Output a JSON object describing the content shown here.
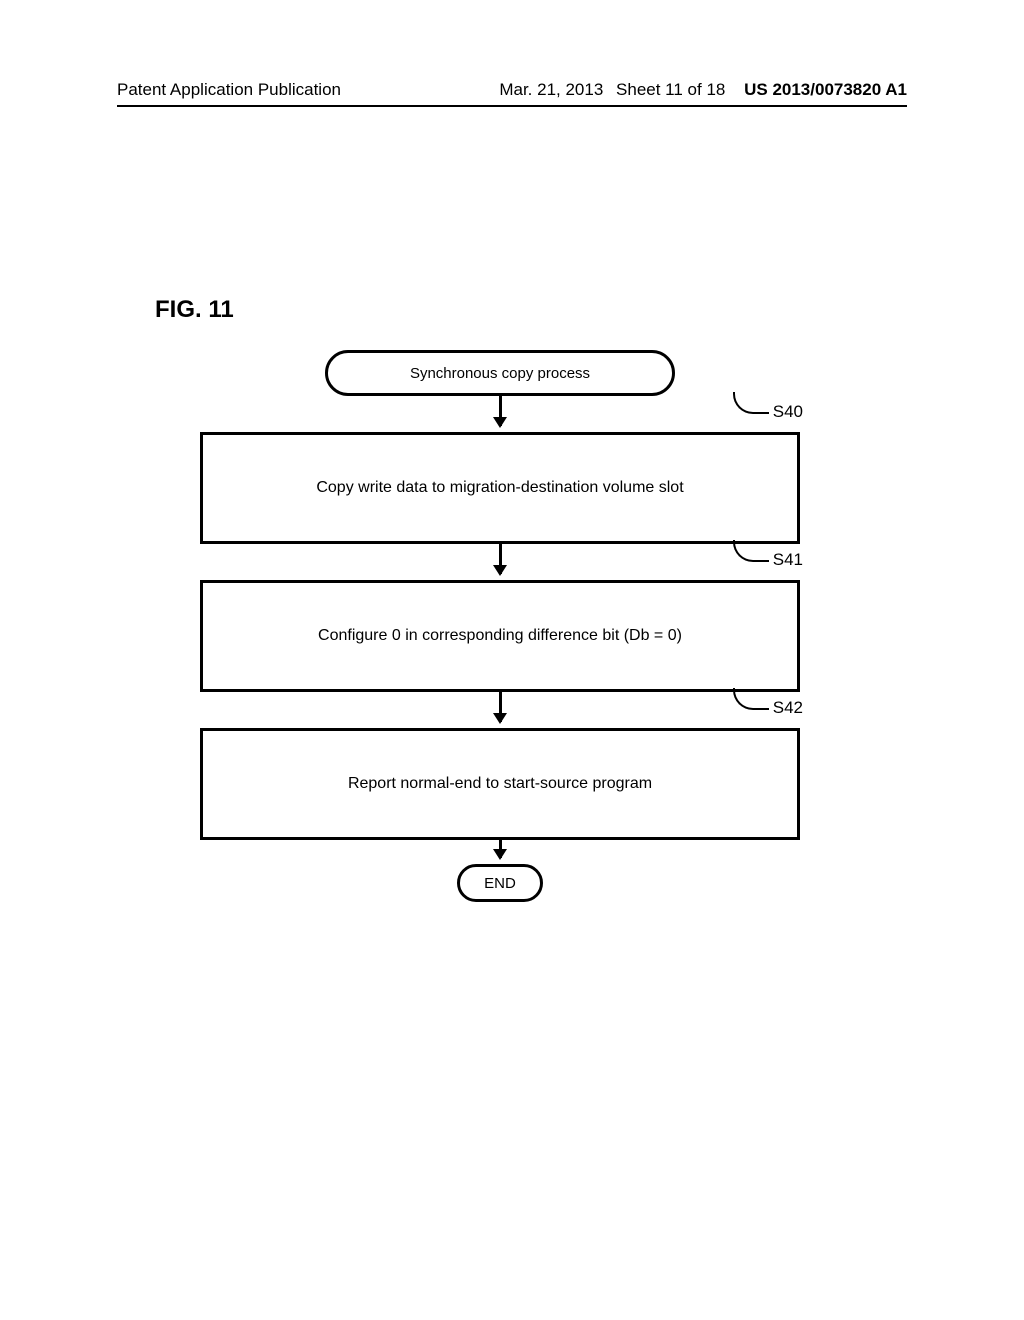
{
  "header": {
    "left": "Patent Application Publication",
    "date": "Mar. 21, 2013",
    "sheet": "Sheet 11 of 18",
    "pub": "US 2013/0073820 A1"
  },
  "figure_label": "FIG. 11",
  "chart_data": {
    "type": "flowchart",
    "title": "Synchronous copy process",
    "nodes": [
      {
        "id": "start",
        "shape": "terminator",
        "text": "Synchronous copy process"
      },
      {
        "id": "S40",
        "shape": "process",
        "label": "S40",
        "text": "Copy write data to migration-destination volume slot"
      },
      {
        "id": "S41",
        "shape": "process",
        "label": "S41",
        "text": "Configure 0 in corresponding difference bit (Db = 0)"
      },
      {
        "id": "S42",
        "shape": "process",
        "label": "S42",
        "text": "Report normal-end to start-source program"
      },
      {
        "id": "end",
        "shape": "terminator",
        "text": "END"
      }
    ],
    "edges": [
      {
        "from": "start",
        "to": "S40"
      },
      {
        "from": "S40",
        "to": "S41"
      },
      {
        "from": "S41",
        "to": "S42"
      },
      {
        "from": "S42",
        "to": "end"
      }
    ]
  }
}
